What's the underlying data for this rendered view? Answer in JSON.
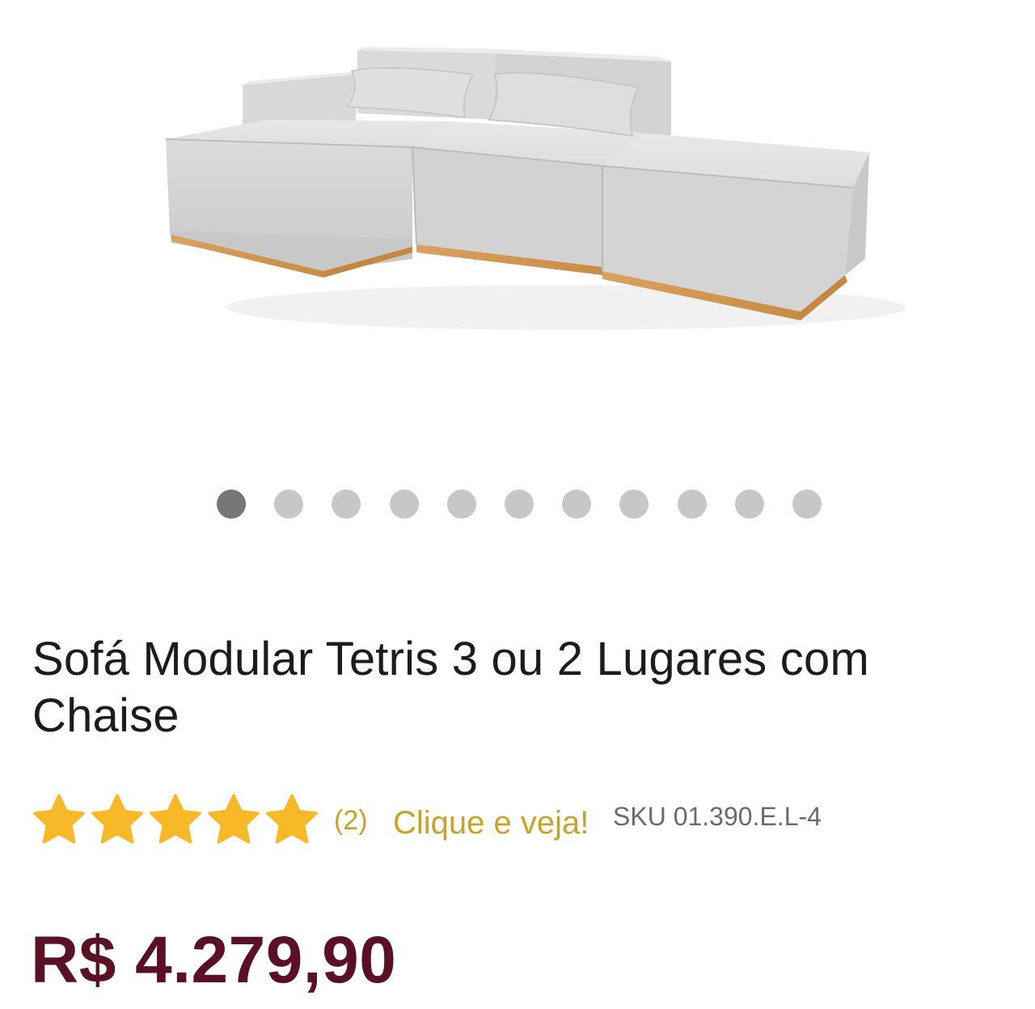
{
  "gallery": {
    "image_alt": "Sofá Modular Tetris",
    "slide_count": 11,
    "active_index": 0,
    "colors": {
      "active_dot": "#777777",
      "inactive_dot": "#c7c7c7"
    }
  },
  "product": {
    "title": "Sofá Modular Tetris 3 ou 2 Lugares com Chaise",
    "rating": {
      "stars": 5,
      "max": 5,
      "count_label": "(2)",
      "link_label": "Clique e veja!",
      "star_color": "#f7b928"
    },
    "sku": "SKU 01.390.E.L-4",
    "price": "R$ 4.279,90",
    "price_color": "#5a1025"
  }
}
